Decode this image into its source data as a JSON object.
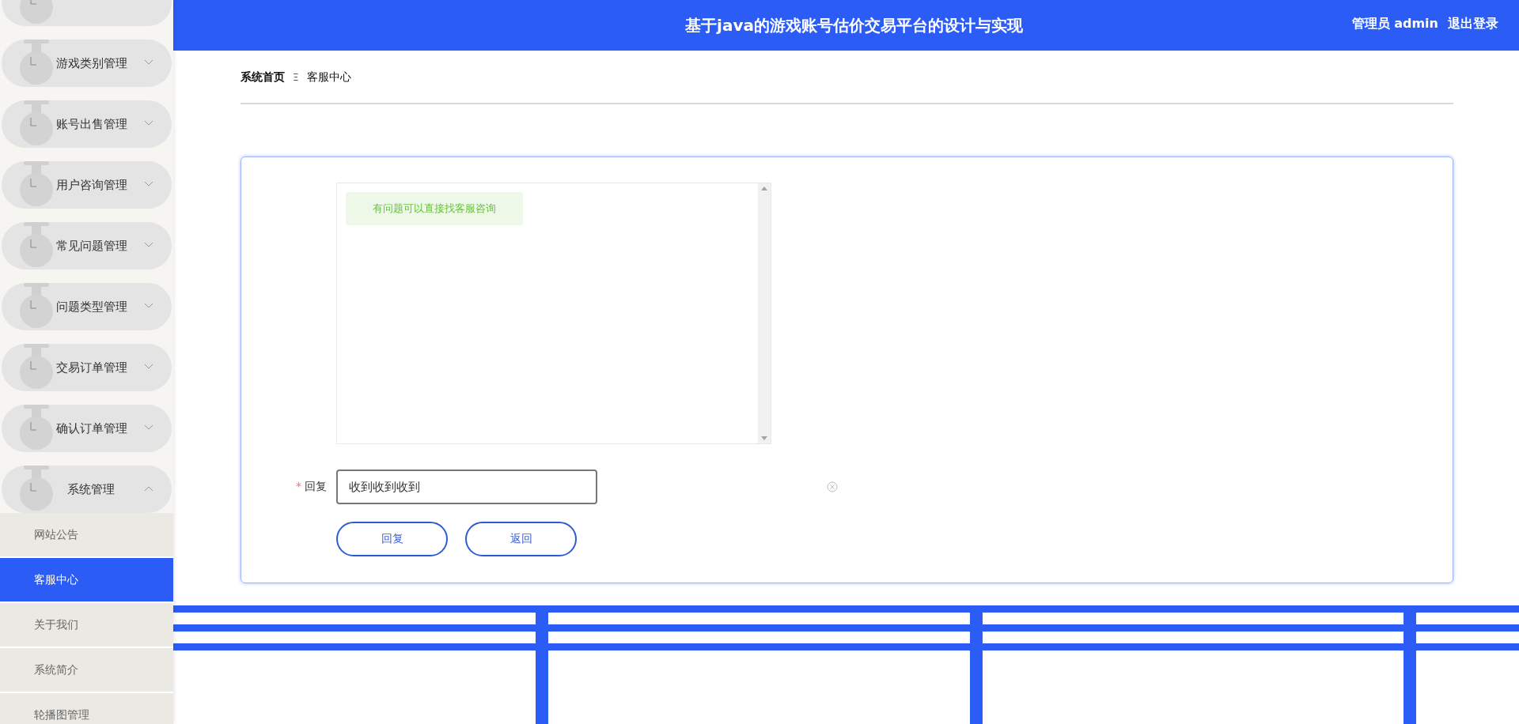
{
  "header": {
    "title": "基于java的游戏账号估价交易平台的设计与实现",
    "user": "管理员 admin",
    "logout": "退出登录"
  },
  "sidebar": {
    "items": [
      {
        "label": "游戏类别管理",
        "expanded": false
      },
      {
        "label": "账号出售管理",
        "expanded": false
      },
      {
        "label": "用户咨询管理",
        "expanded": false
      },
      {
        "label": "常见问题管理",
        "expanded": false
      },
      {
        "label": "问题类型管理",
        "expanded": false
      },
      {
        "label": "交易订单管理",
        "expanded": false
      },
      {
        "label": "确认订单管理",
        "expanded": false
      },
      {
        "label": "系统管理",
        "expanded": true,
        "children": [
          {
            "label": "网站公告",
            "selected": false
          },
          {
            "label": "客服中心",
            "selected": true
          },
          {
            "label": "关于我们",
            "selected": false
          },
          {
            "label": "系统简介",
            "selected": false
          },
          {
            "label": "轮播图管理",
            "selected": false
          }
        ]
      }
    ]
  },
  "breadcrumb": {
    "items": [
      "系统首页",
      "客服中心"
    ],
    "separator": "Ξ"
  },
  "chat": {
    "messages": [
      {
        "text": "有问题可以直接找客服咨询"
      }
    ]
  },
  "form": {
    "required_mark": "*",
    "label": "回复",
    "value": "收到收到收到"
  },
  "buttons": [
    "回复",
    "返回"
  ]
}
